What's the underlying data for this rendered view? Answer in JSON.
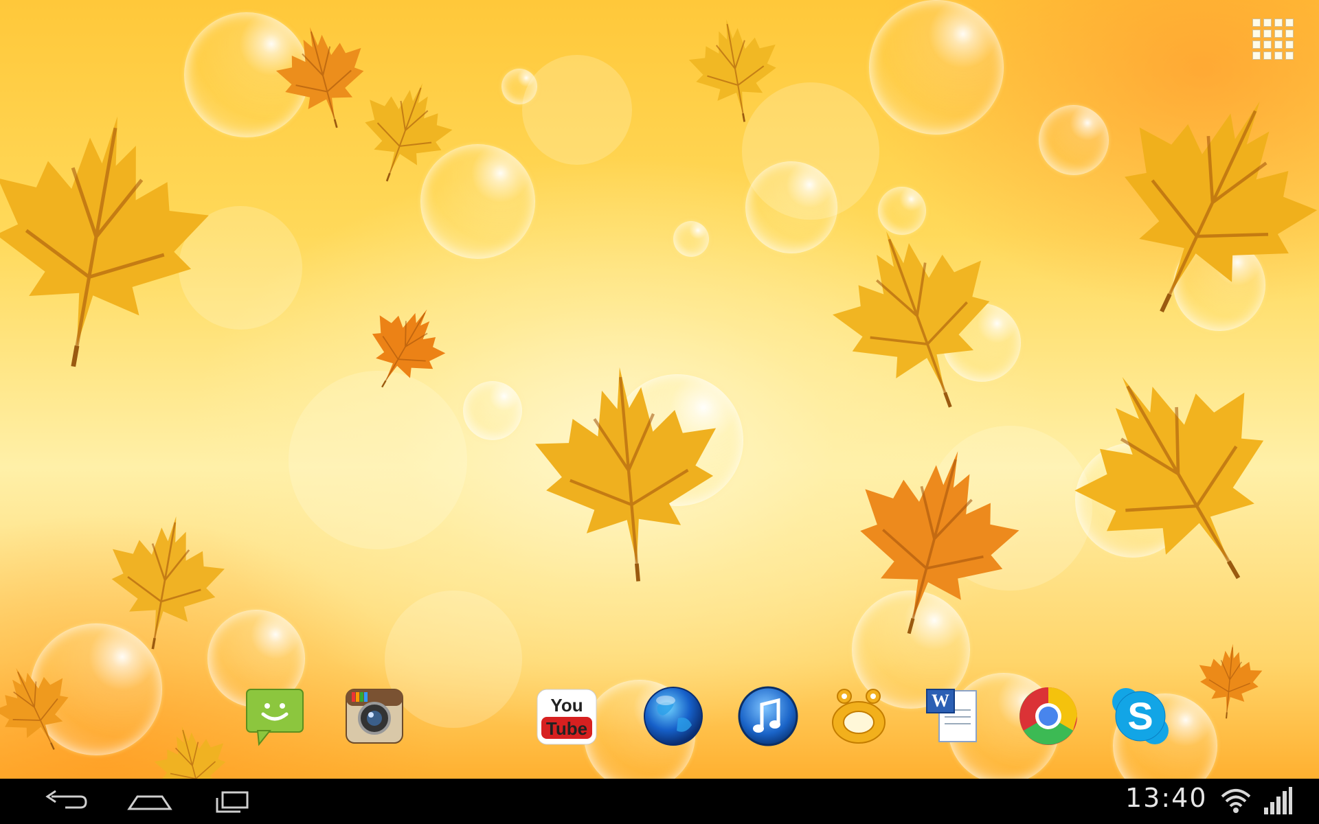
{
  "screen": "android-home-screen",
  "wallpaper": "autumn-leaves-and-bubbles",
  "colors": {
    "leaf_gold": "#f2b21c",
    "leaf_orange": "#ee8a1a",
    "navbar": "#000000",
    "status_text": "#e6e6e6"
  },
  "app_drawer": {
    "icon": "apps-grid-icon"
  },
  "dock": {
    "apps": [
      {
        "name": "Messaging",
        "icon": "messaging-icon"
      },
      {
        "name": "Instagram",
        "icon": "instagram-icon"
      },
      {
        "name": "YouTube",
        "icon": "youtube-icon",
        "logo_text": "You Tube"
      },
      {
        "name": "Browser",
        "icon": "globe-icon"
      },
      {
        "name": "Music",
        "icon": "music-note-icon"
      },
      {
        "name": "GOM Player",
        "icon": "gom-player-icon"
      },
      {
        "name": "Word",
        "icon": "word-doc-icon",
        "logo_text": "W"
      },
      {
        "name": "Chrome",
        "icon": "chrome-icon"
      },
      {
        "name": "Skype",
        "icon": "skype-icon",
        "logo_text": "S"
      }
    ]
  },
  "navbar": {
    "back": "back-icon",
    "home": "home-icon",
    "recents": "recent-apps-icon"
  },
  "status": {
    "time": "13:40",
    "wifi": "wifi-icon",
    "signal": "signal-icon"
  }
}
